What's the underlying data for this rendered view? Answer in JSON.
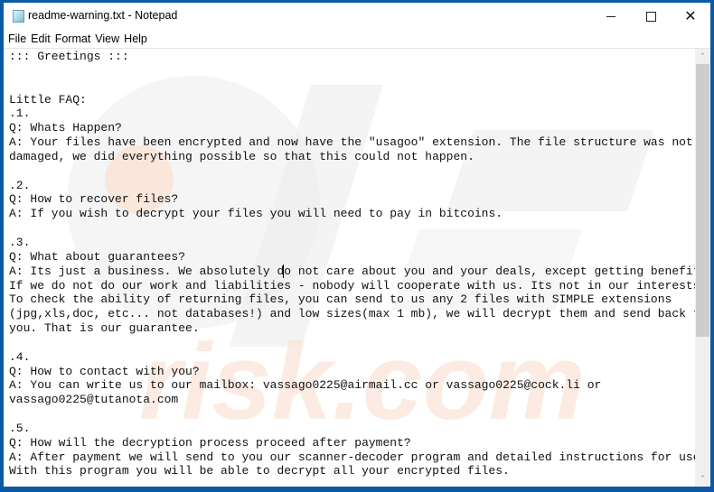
{
  "window": {
    "title": "readme-warning.txt - Notepad",
    "icon": "notepad-icon",
    "controls": {
      "minimize": "minimize-icon",
      "maximize": "maximize-icon",
      "close": "close-icon",
      "close_glyph": "✕"
    }
  },
  "menu": {
    "items": [
      {
        "label": "File"
      },
      {
        "label": "Edit"
      },
      {
        "label": "Format"
      },
      {
        "label": "View"
      },
      {
        "label": "Help"
      }
    ]
  },
  "editor": {
    "lines": [
      "::: Greetings :::",
      "",
      "",
      "Little FAQ:",
      ".1.",
      "Q: Whats Happen?",
      "A: Your files have been encrypted and now have the \"usagoo\" extension. The file structure was not",
      "damaged, we did everything possible so that this could not happen.",
      "",
      ".2.",
      "Q: How to recover files?",
      "A: If you wish to decrypt your files you will need to pay in bitcoins.",
      "",
      ".3.",
      "Q: What about guarantees?",
      "A: Its just a business. We absolutely do not care about you and your deals, except getting benefits.",
      "If we do not do our work and liabilities - nobody will cooperate with us. Its not in our interests.",
      "To check the ability of returning files, you can send to us any 2 files with SIMPLE extensions",
      "(jpg,xls,doc, etc... not databases!) and low sizes(max 1 mb), we will decrypt them and send back to",
      "you. That is our guarantee.",
      "",
      ".4.",
      "Q: How to contact with you?",
      "A: You can write us to our mailbox: vassago0225@airmail.cc or vassago0225@cock.li or",
      "vassago0225@tutanota.com",
      "",
      ".5.",
      "Q: How will the decryption process proceed after payment?",
      "A: After payment we will send to you our scanner-decoder program and detailed instructions for use.",
      "With this program you will be able to decrypt all your encrypted files."
    ]
  },
  "scrollbar": {
    "up_glyph": "˄",
    "down_glyph": "˅"
  },
  "watermark": {
    "text": "risk.com",
    "logo": "pcrisk-logo"
  },
  "colors": {
    "frame": "#0b5aa6",
    "watermark_gray": "#e9e9e9",
    "watermark_orange": "#fbe3d6"
  }
}
